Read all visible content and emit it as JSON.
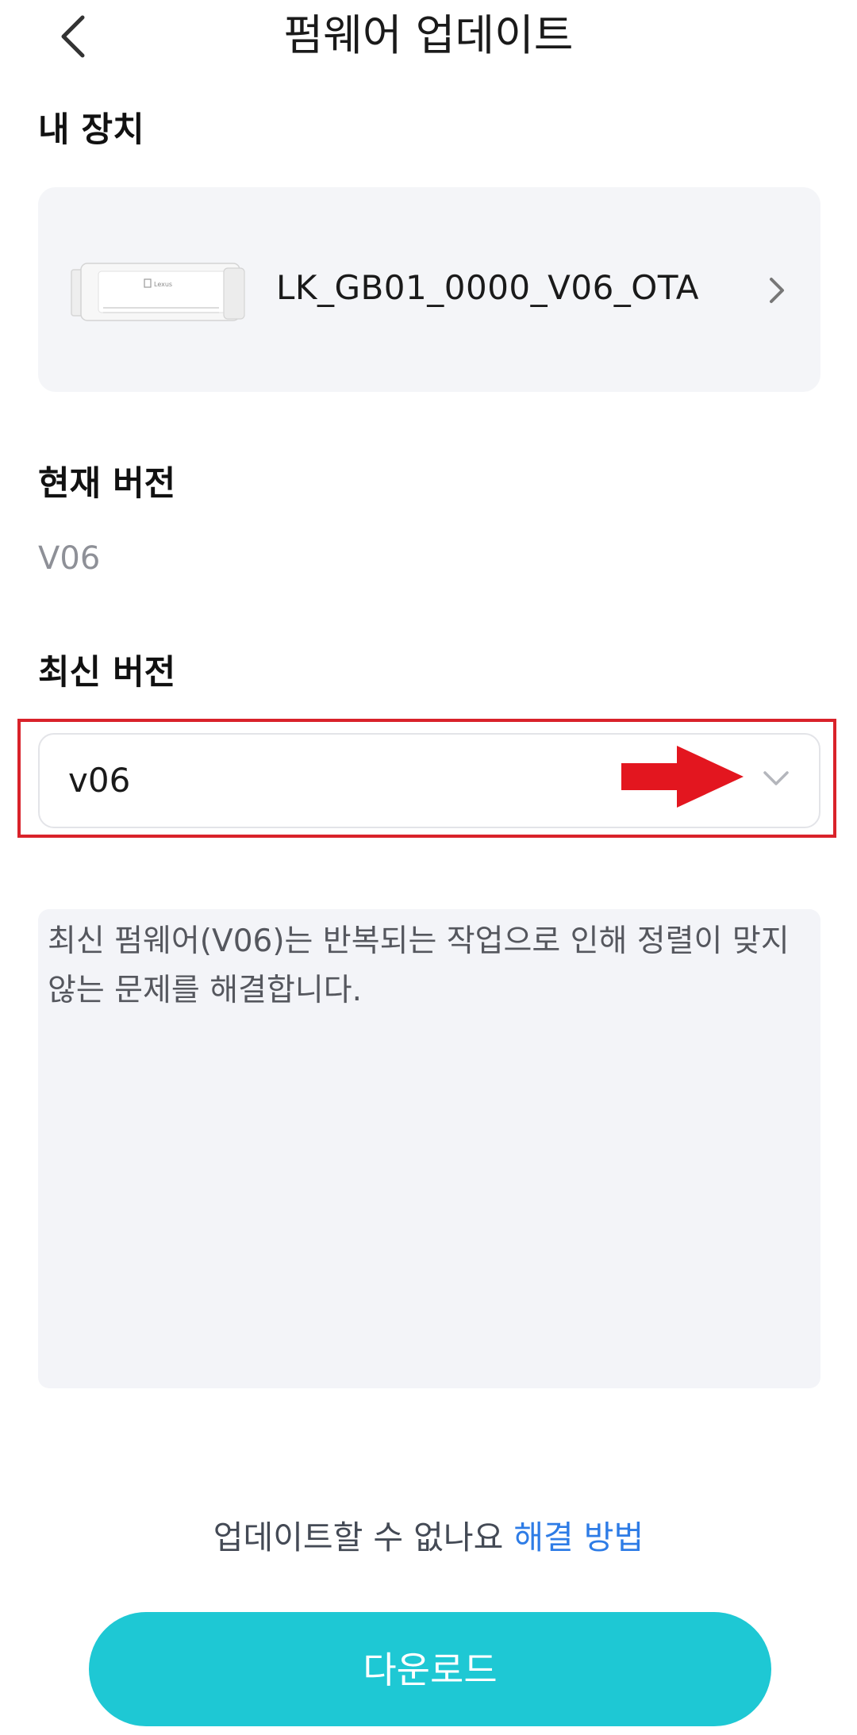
{
  "header": {
    "title": "펌웨어 업데이트",
    "back_icon": "chevron-left-icon"
  },
  "device_section": {
    "title": "내 장치",
    "device_name": "LK_GB01_0000_V06_OTA",
    "printer_logo_text": "Lexus",
    "chevron_icon": "chevron-right-icon"
  },
  "current_version": {
    "title": "현재 버전",
    "value": "V06"
  },
  "latest_version": {
    "title": "최신 버전",
    "selected": "v06",
    "chevron_icon": "chevron-down-icon",
    "annotation": {
      "arrow_color": "#e3161f",
      "box_color": "#d9222a"
    }
  },
  "description": {
    "text": "최신 펌웨어(V06)는 반복되는 작업으로 인해 정렬이 맞지 않는 문제를 해결합니다."
  },
  "help": {
    "prefix": "업데이트할 수 없나요 ",
    "link": "해결 방법"
  },
  "download_button": {
    "label": "다운로드"
  },
  "colors": {
    "accent": "#1ec8d4",
    "link": "#2e7ce6",
    "card_bg": "#f4f5f8",
    "muted_text": "#8e9097"
  }
}
